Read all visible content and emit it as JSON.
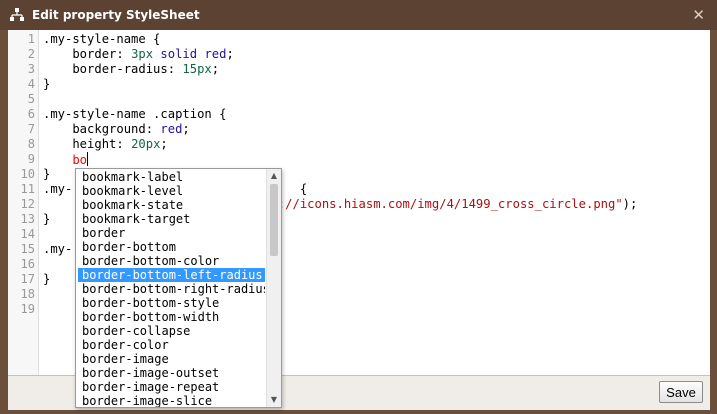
{
  "dialog": {
    "title": "Edit property StyleSheet",
    "close_glyph": "✕",
    "save_label": "Save"
  },
  "editor": {
    "line_numbers": [
      "1",
      "2",
      "3",
      "4",
      "5",
      "6",
      "7",
      "8",
      "9",
      "10",
      "11",
      "12",
      "13",
      "14",
      "15",
      "16",
      "17",
      "18",
      "19"
    ],
    "lines": [
      [
        {
          "t": ".my-style-name {",
          "c": "prop"
        }
      ],
      [
        {
          "t": "    border: ",
          "c": "prop"
        },
        {
          "t": "3px",
          "c": "num"
        },
        {
          "t": " solid ",
          "c": "kw"
        },
        {
          "t": "red",
          "c": "kw"
        },
        {
          "t": ";",
          "c": "prop"
        }
      ],
      [
        {
          "t": "    border-radius: ",
          "c": "prop"
        },
        {
          "t": "15px",
          "c": "num"
        },
        {
          "t": ";",
          "c": "prop"
        }
      ],
      [
        {
          "t": "}",
          "c": "prop"
        }
      ],
      [],
      [
        {
          "t": ".my-style-name .caption {",
          "c": "prop"
        }
      ],
      [
        {
          "t": "    background: ",
          "c": "prop"
        },
        {
          "t": "red",
          "c": "kw"
        },
        {
          "t": ";",
          "c": "prop"
        }
      ],
      [
        {
          "t": "    height: ",
          "c": "prop"
        },
        {
          "t": "20px",
          "c": "num"
        },
        {
          "t": ";",
          "c": "prop"
        }
      ],
      [
        {
          "t": "    bo",
          "c": "err"
        }
      ],
      [
        {
          "t": "}",
          "c": "prop"
        }
      ],
      [
        {
          "t": ".my-",
          "c": "prop"
        },
        {
          "t": "                               {",
          "c": "prop"
        }
      ],
      [
        {
          "t": "                               ",
          "c": "prop"
        },
        {
          "t": "p://icons.hiasm.com/img/4/1499_cross_circle.png\"",
          "c": "str"
        },
        {
          "t": ");",
          "c": "prop"
        }
      ],
      [
        {
          "t": "}",
          "c": "prop"
        }
      ],
      [],
      [
        {
          "t": ".my-",
          "c": "prop"
        }
      ],
      [],
      [
        {
          "t": "}",
          "c": "prop"
        }
      ],
      [],
      []
    ]
  },
  "autocomplete": {
    "items": [
      "bookmark-label",
      "bookmark-level",
      "bookmark-state",
      "bookmark-target",
      "border",
      "border-bottom",
      "border-bottom-color",
      "border-bottom-left-radius",
      "border-bottom-right-radius",
      "border-bottom-style",
      "border-bottom-width",
      "border-collapse",
      "border-color",
      "border-image",
      "border-image-outset",
      "border-image-repeat",
      "border-image-slice"
    ],
    "selected_index": 7,
    "scroll_up_glyph": "▲",
    "scroll_down_glyph": "▼"
  },
  "colors": {
    "titlebar": "#5b4232",
    "selection": "#3399ff",
    "number": "#116644",
    "keyword": "#221199",
    "string": "#aa1111"
  },
  "icons": {
    "app": "tree-nodes-icon",
    "close": "close-icon"
  }
}
